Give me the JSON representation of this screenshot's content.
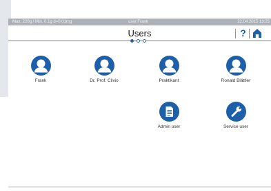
{
  "status_bar": {
    "limits": "Max. 220g / Min. 0.1g  d=0.01mg",
    "user": "user:Frank",
    "datetime": "22.04.2015  13:25"
  },
  "header": {
    "title": "Users",
    "help_label": "?"
  },
  "pager": {
    "pages": 3,
    "current": 1
  },
  "users": [
    {
      "label": "Frank",
      "icon": "user-avatar-icon"
    },
    {
      "label": "Dr. Prof. Clivio",
      "icon": "user-avatar-icon"
    },
    {
      "label": "Praktikant",
      "icon": "user-avatar-icon"
    },
    {
      "label": "Ronald Blättler",
      "icon": "user-avatar-icon"
    }
  ],
  "actions": [
    {
      "label": "Admin user",
      "icon": "document-icon"
    },
    {
      "label": "Service user",
      "icon": "wrench-icon"
    }
  ],
  "colors": {
    "accent": "#1d5fa8",
    "status_bar": "#abb1b7"
  }
}
